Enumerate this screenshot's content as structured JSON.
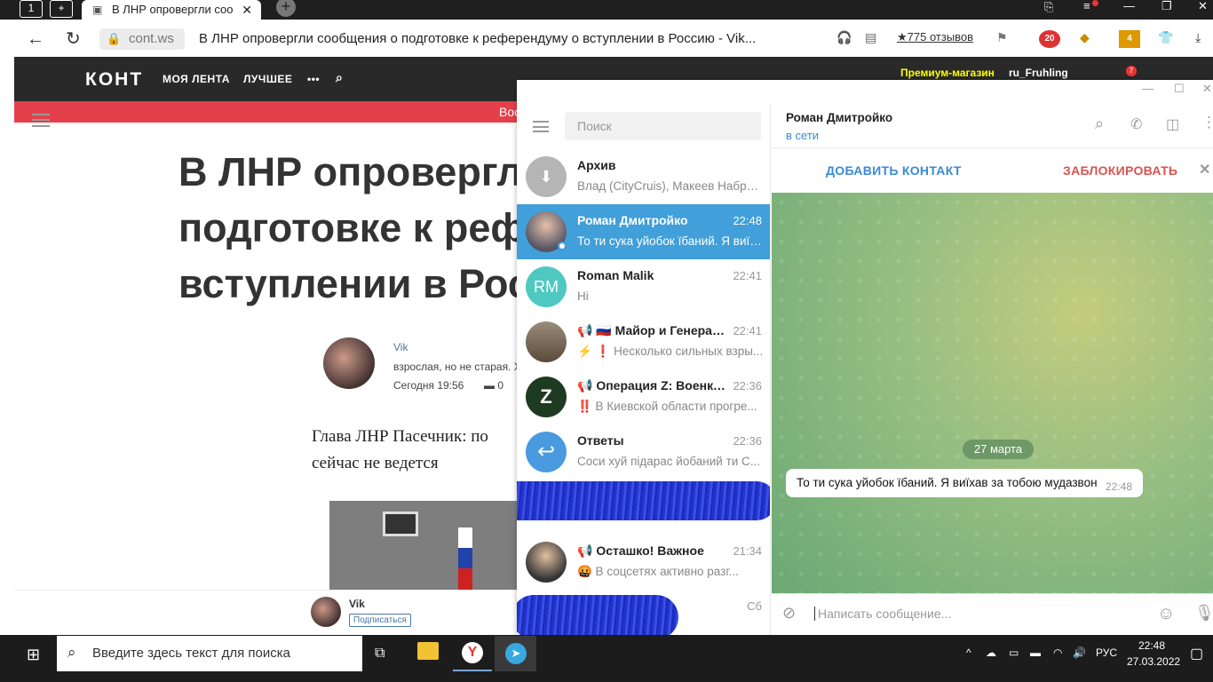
{
  "browser": {
    "tab_title": "В ЛНР опровергли соо",
    "url_host": "cont.ws",
    "page_title": "В ЛНР опровергли сообщения о подготовке к референдуму о вступлении в Россию - Vik...",
    "reviews": "★775 отзывов",
    "badge_20": "20",
    "badge_4": "4"
  },
  "site": {
    "logo": "КОНТ",
    "nav_feed": "МОЯ ЛЕНТА",
    "nav_best": "ЛУЧШЕЕ",
    "nav_more": "•••",
    "premium": "Премиум-магазин",
    "username": "ru_Fruhling",
    "notif_count": "7",
    "redbar_text": "Вос",
    "headline_1": "В ЛНР опровергл",
    "headline_2": "подготовке к реф",
    "headline_3": "вступлении в Рос",
    "author": "Vik",
    "author_bio": "взрослая, но не старая. Х",
    "post_time": "Сегодня 19:56",
    "comments": "0",
    "lead_1": "Глава ЛНР Пасечник: по",
    "lead_2": "сейчас не ведется",
    "footer_author": "Vik",
    "subscribe": "Подписаться"
  },
  "telegram": {
    "search_placeholder": "Поиск",
    "chats": [
      {
        "name": "Архив",
        "time": "",
        "msg": "Влад (CityCruis), Макеев Набрат..."
      },
      {
        "name": "Роман Дмитройко",
        "time": "22:48",
        "msg": "То ти сука уйобок їбаний. Я виїх..."
      },
      {
        "name": "Roman Malik",
        "initials": "RM",
        "time": "22:41",
        "msg": "Hi"
      },
      {
        "name": "📢 🇷🇺 Майор и Генерал ...",
        "time": "22:41",
        "msg": "⚡ ❗ Несколько сильных взры..."
      },
      {
        "name": "📢 Операция Z: Военкор...",
        "time": "22:36",
        "msg": "‼️ В Киевской области прогре..."
      },
      {
        "name": "Ответы",
        "time": "22:36",
        "msg": "Соси хуй підарас йобаний ти  С..."
      },
      {
        "name": "📢 Осташко! Важное",
        "time": "21:34",
        "msg": "🤬 В соцсетях активно разг..."
      },
      {
        "name": "",
        "time": "Сб",
        "msg": ""
      }
    ],
    "chat_header_name": "Роман Дмитройко",
    "chat_header_status": "в сети",
    "add_contact": "ДОБАВИТЬ КОНТАКТ",
    "block": "ЗАБЛОКИРОВАТЬ",
    "date_divider": "27 марта",
    "message_text": "То ти сука уйобок їбаний. Я виїхав за тобою мудазвон",
    "message_time": "22:48",
    "composer_placeholder": "Написать сообщение..."
  },
  "taskbar": {
    "search_placeholder": "Введите здесь текст для поиска",
    "lang": "РУС",
    "time": "22:48",
    "date": "27.03.2022"
  },
  "colors": {
    "telegram_blue": "#419fd9",
    "site_header": "#292929",
    "site_red": "#e3404b",
    "tg_action": "#3a8ad6",
    "tg_block": "#d9534f"
  }
}
